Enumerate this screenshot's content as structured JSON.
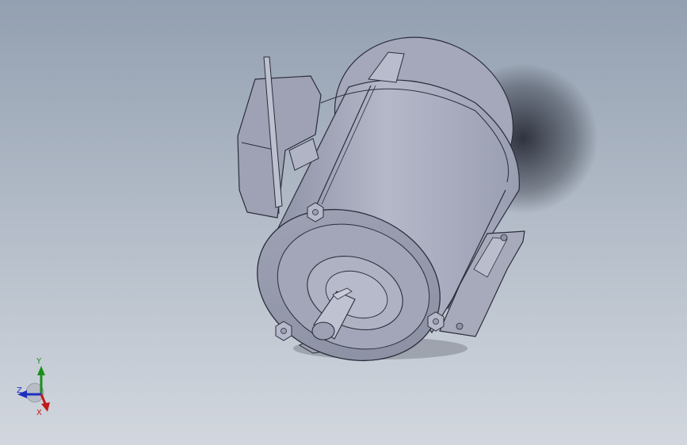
{
  "viewport": {
    "background_top": "#93a0b1",
    "background_bottom": "#d2d7de"
  },
  "model": {
    "body_color": "#a8acbe",
    "edge_color": "#2b2d3a",
    "shadow_color": "#1a1d28"
  },
  "triad": {
    "y_label": "Y",
    "z_label": "Z",
    "x_label": "X",
    "y_color": "#1b8f1b",
    "z_color": "#1e2fbf",
    "x_color": "#c21b1b"
  }
}
